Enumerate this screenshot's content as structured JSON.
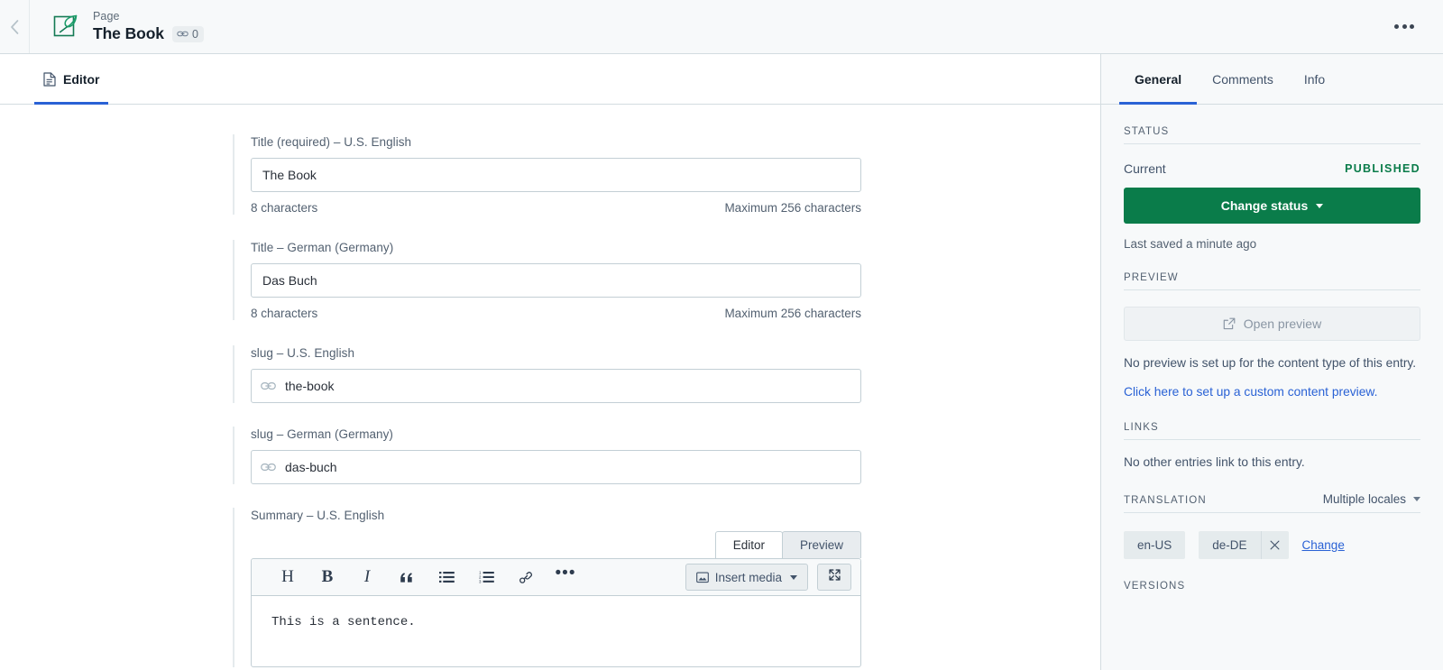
{
  "topbar": {
    "back_icon": "chevron-left-icon",
    "logo_icon": "page-feather-logo-icon",
    "kicker": "Page",
    "title": "The Book",
    "link_badge": {
      "icon": "link-chain-icon",
      "count": "0"
    },
    "overflow_icon": "ellipsis-horizontal-icon"
  },
  "editor": {
    "tabs": [
      {
        "label": "Editor",
        "icon": "document-icon",
        "active": true
      }
    ],
    "fields": [
      {
        "label": "Title (required) – U.S. English",
        "value": "The Book",
        "placeholder": "",
        "icon": "",
        "char_count": "8 characters",
        "char_max": "Maximum 256 characters"
      },
      {
        "label": "Title – German (Germany)",
        "value": "Das Buch",
        "placeholder": "",
        "icon": "",
        "char_count": "8 characters",
        "char_max": "Maximum 256 characters"
      },
      {
        "label": "slug – U.S. English",
        "value": "the-book",
        "placeholder": "",
        "icon": "link-chain-icon",
        "char_count": "",
        "char_max": ""
      },
      {
        "label": "slug – German (Germany)",
        "value": "das-buch",
        "placeholder": "",
        "icon": "link-chain-icon",
        "char_count": "",
        "char_max": ""
      }
    ],
    "richtext": {
      "label": "Summary – U.S. English",
      "view_tabs": [
        {
          "label": "Editor",
          "active": true
        },
        {
          "label": "Preview",
          "active": false
        }
      ],
      "toolbar_buttons": [
        {
          "name": "heading-button",
          "glyph": "H",
          "icon": "heading-icon"
        },
        {
          "name": "bold-button",
          "glyph": "B",
          "icon": "bold-icon"
        },
        {
          "name": "italic-button",
          "glyph": "I",
          "icon": "italic-icon"
        },
        {
          "name": "blockquote-button",
          "glyph": "“",
          "icon": "quote-icon"
        },
        {
          "name": "bulleted-list-button",
          "glyph": "",
          "icon": "unordered-list-icon"
        },
        {
          "name": "numbered-list-button",
          "glyph": "",
          "icon": "ordered-list-icon"
        },
        {
          "name": "hyperlink-button",
          "glyph": "",
          "icon": "link-icon"
        },
        {
          "name": "more-options-button",
          "glyph": "•••",
          "icon": "ellipsis-icon"
        }
      ],
      "insert_media_label": "Insert media",
      "insert_media_icon": "image-icon",
      "expand_icon": "fullscreen-expand-icon",
      "content": "This is a sentence."
    }
  },
  "sidebar": {
    "tabs": [
      {
        "label": "General",
        "active": true
      },
      {
        "label": "Comments",
        "active": false
      },
      {
        "label": "Info",
        "active": false
      }
    ],
    "status": {
      "section_title": "STATUS",
      "current_label": "Current",
      "current_value": "PUBLISHED",
      "current_value_color": "#0a7c4a",
      "change_status_label": "Change status",
      "last_saved": "Last saved a minute ago"
    },
    "preview": {
      "section_title": "PREVIEW",
      "open_preview_label": "Open preview",
      "open_preview_icon": "external-link-icon",
      "note": "No preview is set up for the content type of this entry.",
      "link": "Click here to set up a custom content preview."
    },
    "links": {
      "section_title": "LINKS",
      "note": "No other entries link to this entry."
    },
    "translation": {
      "section_title": "TRANSLATION",
      "mode_label": "Multiple locales",
      "locales": [
        {
          "label": "en-US",
          "removable": false
        },
        {
          "label": "de-DE",
          "removable": true
        }
      ],
      "remove_icon": "close-x-icon",
      "change_label": "Change"
    },
    "versions": {
      "section_title": "VERSIONS"
    }
  },
  "colors": {
    "accent_blue": "#2a62d5",
    "brand_green": "#0a7c4a",
    "sidebar_bg": "#f7f9fa",
    "border": "#d3dce0"
  }
}
